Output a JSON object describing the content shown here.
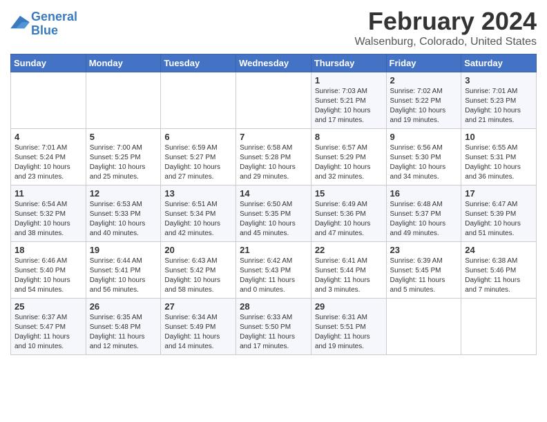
{
  "header": {
    "logo_line1": "General",
    "logo_line2": "Blue",
    "title": "February 2024",
    "subtitle": "Walsenburg, Colorado, United States"
  },
  "days_of_week": [
    "Sunday",
    "Monday",
    "Tuesday",
    "Wednesday",
    "Thursday",
    "Friday",
    "Saturday"
  ],
  "weeks": [
    [
      {
        "day": "",
        "info": ""
      },
      {
        "day": "",
        "info": ""
      },
      {
        "day": "",
        "info": ""
      },
      {
        "day": "",
        "info": ""
      },
      {
        "day": "1",
        "info": "Sunrise: 7:03 AM\nSunset: 5:21 PM\nDaylight: 10 hours\nand 17 minutes."
      },
      {
        "day": "2",
        "info": "Sunrise: 7:02 AM\nSunset: 5:22 PM\nDaylight: 10 hours\nand 19 minutes."
      },
      {
        "day": "3",
        "info": "Sunrise: 7:01 AM\nSunset: 5:23 PM\nDaylight: 10 hours\nand 21 minutes."
      }
    ],
    [
      {
        "day": "4",
        "info": "Sunrise: 7:01 AM\nSunset: 5:24 PM\nDaylight: 10 hours\nand 23 minutes."
      },
      {
        "day": "5",
        "info": "Sunrise: 7:00 AM\nSunset: 5:25 PM\nDaylight: 10 hours\nand 25 minutes."
      },
      {
        "day": "6",
        "info": "Sunrise: 6:59 AM\nSunset: 5:27 PM\nDaylight: 10 hours\nand 27 minutes."
      },
      {
        "day": "7",
        "info": "Sunrise: 6:58 AM\nSunset: 5:28 PM\nDaylight: 10 hours\nand 29 minutes."
      },
      {
        "day": "8",
        "info": "Sunrise: 6:57 AM\nSunset: 5:29 PM\nDaylight: 10 hours\nand 32 minutes."
      },
      {
        "day": "9",
        "info": "Sunrise: 6:56 AM\nSunset: 5:30 PM\nDaylight: 10 hours\nand 34 minutes."
      },
      {
        "day": "10",
        "info": "Sunrise: 6:55 AM\nSunset: 5:31 PM\nDaylight: 10 hours\nand 36 minutes."
      }
    ],
    [
      {
        "day": "11",
        "info": "Sunrise: 6:54 AM\nSunset: 5:32 PM\nDaylight: 10 hours\nand 38 minutes."
      },
      {
        "day": "12",
        "info": "Sunrise: 6:53 AM\nSunset: 5:33 PM\nDaylight: 10 hours\nand 40 minutes."
      },
      {
        "day": "13",
        "info": "Sunrise: 6:51 AM\nSunset: 5:34 PM\nDaylight: 10 hours\nand 42 minutes."
      },
      {
        "day": "14",
        "info": "Sunrise: 6:50 AM\nSunset: 5:35 PM\nDaylight: 10 hours\nand 45 minutes."
      },
      {
        "day": "15",
        "info": "Sunrise: 6:49 AM\nSunset: 5:36 PM\nDaylight: 10 hours\nand 47 minutes."
      },
      {
        "day": "16",
        "info": "Sunrise: 6:48 AM\nSunset: 5:37 PM\nDaylight: 10 hours\nand 49 minutes."
      },
      {
        "day": "17",
        "info": "Sunrise: 6:47 AM\nSunset: 5:39 PM\nDaylight: 10 hours\nand 51 minutes."
      }
    ],
    [
      {
        "day": "18",
        "info": "Sunrise: 6:46 AM\nSunset: 5:40 PM\nDaylight: 10 hours\nand 54 minutes."
      },
      {
        "day": "19",
        "info": "Sunrise: 6:44 AM\nSunset: 5:41 PM\nDaylight: 10 hours\nand 56 minutes."
      },
      {
        "day": "20",
        "info": "Sunrise: 6:43 AM\nSunset: 5:42 PM\nDaylight: 10 hours\nand 58 minutes."
      },
      {
        "day": "21",
        "info": "Sunrise: 6:42 AM\nSunset: 5:43 PM\nDaylight: 11 hours\nand 0 minutes."
      },
      {
        "day": "22",
        "info": "Sunrise: 6:41 AM\nSunset: 5:44 PM\nDaylight: 11 hours\nand 3 minutes."
      },
      {
        "day": "23",
        "info": "Sunrise: 6:39 AM\nSunset: 5:45 PM\nDaylight: 11 hours\nand 5 minutes."
      },
      {
        "day": "24",
        "info": "Sunrise: 6:38 AM\nSunset: 5:46 PM\nDaylight: 11 hours\nand 7 minutes."
      }
    ],
    [
      {
        "day": "25",
        "info": "Sunrise: 6:37 AM\nSunset: 5:47 PM\nDaylight: 11 hours\nand 10 minutes."
      },
      {
        "day": "26",
        "info": "Sunrise: 6:35 AM\nSunset: 5:48 PM\nDaylight: 11 hours\nand 12 minutes."
      },
      {
        "day": "27",
        "info": "Sunrise: 6:34 AM\nSunset: 5:49 PM\nDaylight: 11 hours\nand 14 minutes."
      },
      {
        "day": "28",
        "info": "Sunrise: 6:33 AM\nSunset: 5:50 PM\nDaylight: 11 hours\nand 17 minutes."
      },
      {
        "day": "29",
        "info": "Sunrise: 6:31 AM\nSunset: 5:51 PM\nDaylight: 11 hours\nand 19 minutes."
      },
      {
        "day": "",
        "info": ""
      },
      {
        "day": "",
        "info": ""
      }
    ]
  ]
}
